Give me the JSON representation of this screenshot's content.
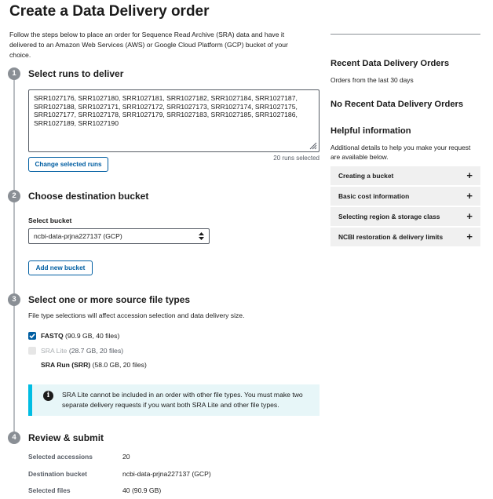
{
  "page": {
    "title": "Create a Data Delivery order",
    "intro": "Follow the steps below to place an order for Sequence Read Archive (SRA) data and have it delivered to an Amazon Web Services (AWS) or Google Cloud Platform (GCP) bucket of your choice."
  },
  "steps": [
    {
      "number": "1",
      "title": "Select runs to deliver"
    },
    {
      "number": "2",
      "title": "Choose destination bucket"
    },
    {
      "number": "3",
      "title": "Select one or more source file types"
    },
    {
      "number": "4",
      "title": "Review & submit"
    }
  ],
  "runs": {
    "text": "SRR1027176, SRR1027180, SRR1027181, SRR1027182, SRR1027184, SRR1027187, SRR1027188, SRR1027171, SRR1027172, SRR1027173, SRR1027174, SRR1027175, SRR1027177, SRR1027178, SRR1027179, SRR1027183, SRR1027185, SRR1027186, SRR1027189, SRR1027190",
    "count_label": "20 runs selected",
    "change_button": "Change selected runs"
  },
  "bucket": {
    "label": "Select bucket",
    "selected": "ncbi-data-prjna227137 (GCP)",
    "add_button": "Add new bucket"
  },
  "file_types": {
    "help": "File type selections will affect accession selection and data delivery size.",
    "options": [
      {
        "name": "FASTQ",
        "detail": "(90.9 GB, 40 files)",
        "state": "checked"
      },
      {
        "name": "SRA Lite",
        "detail": "(28.7 GB, 20 files)",
        "state": "disabled"
      },
      {
        "name": "SRA Run (SRR)",
        "detail": "(58.0 GB, 20 files)",
        "state": "none"
      }
    ],
    "alert": "SRA Lite cannot be included in an order with other file types. You must make two separate delivery requests if you want both SRA Lite and other file types."
  },
  "review": {
    "rows": [
      {
        "label": "Selected accessions",
        "value": "20"
      },
      {
        "label": "Destination bucket",
        "value": "ncbi-data-prjna227137 (GCP)"
      },
      {
        "label": "Selected files",
        "value": "40 (90.9 GB)"
      }
    ]
  },
  "sidebar": {
    "recent_heading": "Recent Data Delivery Orders",
    "recent_sub": "Orders from the last 30 days",
    "no_recent": "No Recent Data Delivery Orders",
    "help_heading": "Helpful information",
    "help_text": "Additional details to help you make your request are available below.",
    "accordion": [
      {
        "label": "Creating a bucket"
      },
      {
        "label": "Basic cost information"
      },
      {
        "label": "Selecting region & storage class"
      },
      {
        "label": "NCBI restoration & delivery limits"
      }
    ],
    "plus_glyph": "+"
  },
  "colors": {
    "primary": "#005ea2",
    "alert_bg": "#e7f6f8",
    "alert_border": "#00bde3",
    "step_circle": "#8a8f95"
  },
  "icons": {
    "info": "info-icon",
    "check": "check-icon",
    "resize": "resize-handle-icon",
    "select_arrows": "select-arrows-icon"
  }
}
